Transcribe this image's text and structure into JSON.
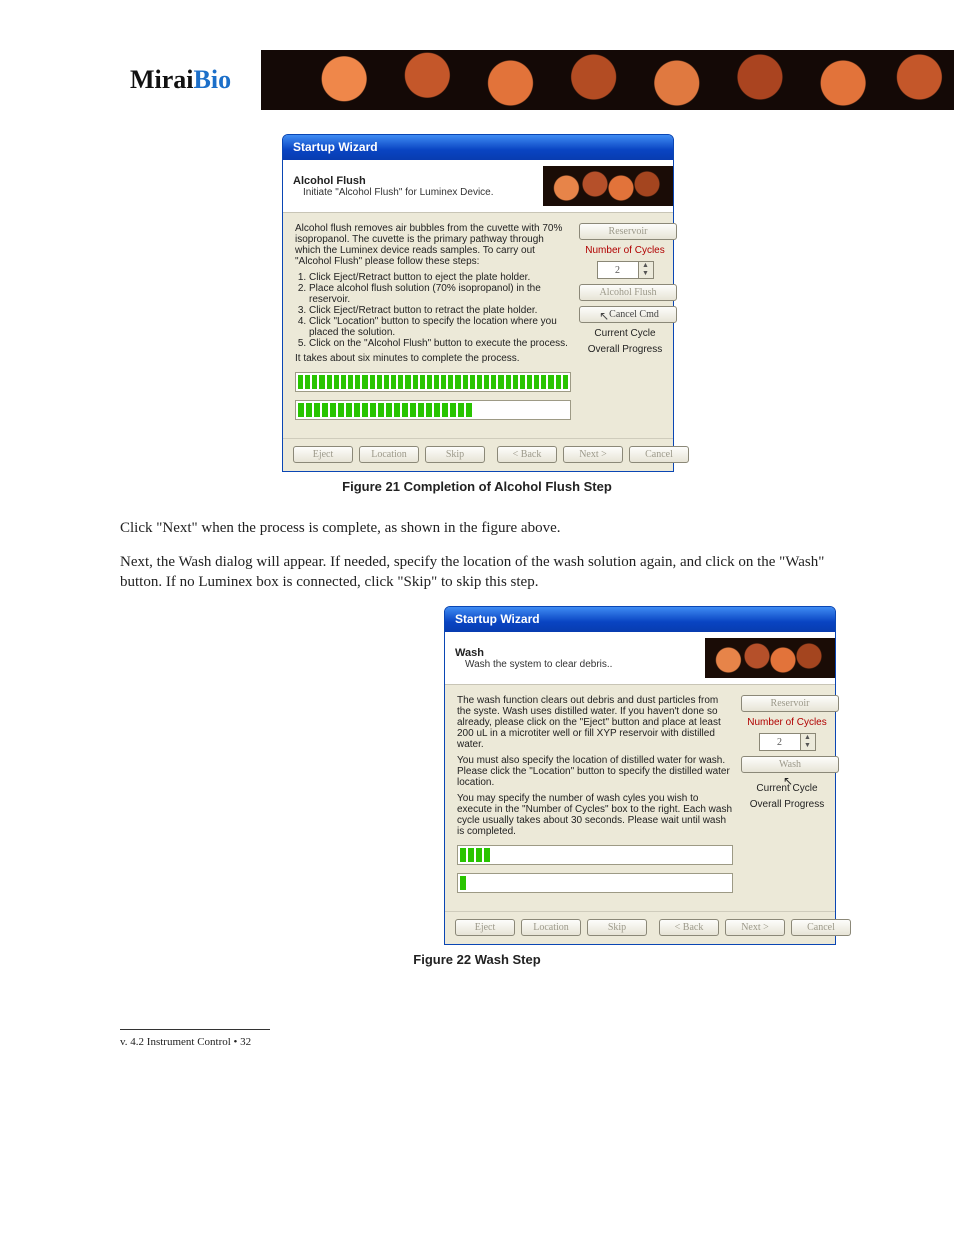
{
  "brand": {
    "name_a": "Mirai",
    "name_b": "Bio"
  },
  "doc": {
    "after_fig21": "Click \"Next\" when the process is complete, as shown in the figure above.",
    "wash_intro": "Next, the Wash dialog will appear.  If needed, specify the location of the wash solution again, and click on the \"Wash\" button. If no Luminex box is connected, click \"Skip\" to skip this step.",
    "cap21": "Figure 21 Completion of Alcohol Flush Step",
    "cap22": "Figure 22 Wash Step",
    "footnote": "v. 4.2 Instrument Control • 32"
  },
  "win1": {
    "title": "Startup Wizard",
    "h": "Alcohol Flush",
    "sub": "Initiate \"Alcohol Flush\" for Luminex Device.",
    "intro": "Alcohol flush removes air bubbles from the cuvette with 70% isopropanol. The cuvette is the primary pathway through which the Luminex device reads samples. To carry out \"Alcohol Flush\" please follow these steps:",
    "steps": [
      "Click Eject/Retract button to eject the plate holder.",
      "Place alcohol flush solution (70% isopropanol) in the reservoir.",
      "Click Eject/Retract button to retract the plate holder.",
      "Click \"Location\" button to specify the location where you placed the solution.",
      "Click on the \"Alcohol Flush\" button to execute the process."
    ],
    "tail": "It takes about six minutes to complete the process.",
    "side": {
      "reservoir": "Reservoir",
      "cycles_l": "Number of Cycles",
      "cycles_v": "2",
      "action": "Alcohol Flush",
      "cancel_cmd": "Cancel Cmd",
      "cur": "Current Cycle",
      "ov": "Overall Progress"
    },
    "foot": {
      "eject": "Eject",
      "loc": "Location",
      "skip": "Skip",
      "back": "< Back",
      "next": "Next >",
      "cancel": "Cancel"
    }
  },
  "win2": {
    "title": "Startup Wizard",
    "h": "Wash",
    "sub": "Wash the system to clear debris..",
    "p1": "The wash function clears out debris and dust particles from the syste. Wash uses distilled water. If you haven't done so already, please click on the \"Eject\" button and place at least 200 uL in a microtiter well or fill XYP reservoir with distilled water.",
    "p2": "You must also specify the location of distilled water for wash. Please click the \"Location\" button to specify the distilled water location.",
    "p3": "You may specify the number of wash cyles you wish to execute in the \"Number of Cycles\" box to the right. Each wash cycle usually takes about 30 seconds. Please wait until wash is completed.",
    "side": {
      "reservoir": "Reservoir",
      "cycles_l": "Number of Cycles",
      "cycles_v": "2",
      "action": "Wash",
      "cur": "Current Cycle",
      "ov": "Overall Progress"
    },
    "foot": {
      "eject": "Eject",
      "loc": "Location",
      "skip": "Skip",
      "back": "< Back",
      "next": "Next >",
      "cancel": "Cancel"
    }
  },
  "prog": {
    "win1_current": 38,
    "win1_overall": 22,
    "win2_current": 4,
    "win2_overall": 1
  }
}
